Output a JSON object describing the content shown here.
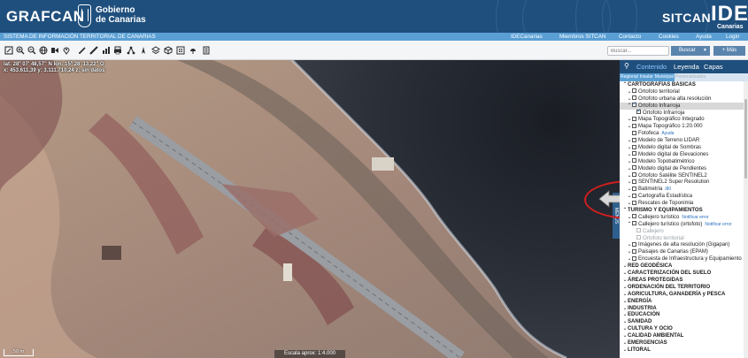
{
  "header": {
    "brand": "GRAFCAN",
    "gov_line1": "Gobierno",
    "gov_line2": "de Canarias",
    "sitcan": "SITCAN",
    "ide": "IDE",
    "ide_sub": "Canarias",
    "bg_color": "#1f4f7d"
  },
  "nav": {
    "title": "SISTEMA DE INFORMACIÓN TERRITORIAL DE CANARIAS",
    "links": [
      "IDECanarias",
      "Miembros SITCAN",
      "Contacto",
      "Cookies",
      "Ayuda",
      "Login"
    ],
    "bg_color": "#5a9fd4"
  },
  "toolbar": {
    "icons": [
      "measure-icon",
      "zoom-in-icon",
      "zoom-out-icon",
      "globe-icon",
      "share-icon",
      "location-icon",
      "draw-icon",
      "ruler-icon",
      "chart-icon",
      "print-icon",
      "network-icon",
      "compass-icon",
      "layers-icon",
      "cube-icon",
      "building-icon",
      "weather-icon",
      "document-icon"
    ],
    "search_placeholder": "Buscar...",
    "search_button": "Buscar",
    "more_button": "+ Más"
  },
  "map": {
    "coord_line1": "lat: 28º 07' 48,57\" N  lon: 15º 28' 13,22\" O",
    "coord_line2": "x: 453.611,39  y: 3.111.710,24  z: sin datos",
    "scale_bar": "50 m",
    "scale_text": "Escala aprox: 1:4.000",
    "side_tab": "MENÚS"
  },
  "panel": {
    "search_icon": "search-icon",
    "tabs": [
      "Contenido",
      "Leyenda",
      "Capas"
    ],
    "active_tab": "Contenido",
    "subtabs": [
      "Regional",
      "Insular",
      "Municipal",
      "Personalizados"
    ],
    "tree": [
      {
        "chev": "^",
        "cb": "none",
        "label": "CARTOGRAFÍAS BÁSICAS",
        "indent": 0,
        "cat": true
      },
      {
        "chev": "v",
        "cb": "off",
        "label": "Ortofoto territorial",
        "indent": 1
      },
      {
        "chev": "v",
        "cb": "off",
        "label": "Ortofoto urbana alta resolución",
        "indent": 1
      },
      {
        "chev": "^",
        "cb": "on",
        "label": "Ortofoto Infrarroja",
        "indent": 1,
        "selected": true
      },
      {
        "chev": "",
        "cb": "on",
        "label": "Ortofoto Infrarroja",
        "indent": 2
      },
      {
        "chev": "v",
        "cb": "off",
        "label": "Mapa Topográfico Integrado",
        "indent": 1
      },
      {
        "chev": "v",
        "cb": "off",
        "label": "Mapa Topográfico 1:20.000",
        "indent": 1
      },
      {
        "chev": "",
        "cb": "off",
        "label": "Fotofeca",
        "indent": 1,
        "note": "Ayuda"
      },
      {
        "chev": "v",
        "cb": "off",
        "label": "Modelo de Terreno LIDAR",
        "indent": 1
      },
      {
        "chev": "v",
        "cb": "off",
        "label": "Modelo digital de Sombras",
        "indent": 1
      },
      {
        "chev": "v",
        "cb": "off",
        "label": "Modelo digital de Elevaciones",
        "indent": 1
      },
      {
        "chev": "v",
        "cb": "off",
        "label": "Modelo Topobatimétrico",
        "indent": 1
      },
      {
        "chev": "v",
        "cb": "off",
        "label": "Modelo digital de Pendientes",
        "indent": 1
      },
      {
        "chev": "v",
        "cb": "off",
        "label": "Ortofoto Satélite SENTINEL2",
        "indent": 1
      },
      {
        "chev": "v",
        "cb": "off",
        "label": "SENTINEL2 Super Resolution",
        "indent": 1
      },
      {
        "chev": "v",
        "cb": "off",
        "label": "Batimetría",
        "indent": 1,
        "note": "i80"
      },
      {
        "chev": "v",
        "cb": "off",
        "label": "Cartografía Estadística",
        "indent": 1
      },
      {
        "chev": "v",
        "cb": "off",
        "label": "Rescates de Toponimia",
        "indent": 1
      },
      {
        "chev": "^",
        "cb": "none",
        "label": "TURISMO Y EQUIPAMIENTOS",
        "indent": 0,
        "cat": true
      },
      {
        "chev": "v",
        "cb": "off",
        "label": "Callejero turístico",
        "indent": 1,
        "note": "Notificar error"
      },
      {
        "chev": "^",
        "cb": "off",
        "label": "Callejero turístico (ortofoto)",
        "indent": 1,
        "note": "Notificar error"
      },
      {
        "chev": "",
        "cb": "dis",
        "label": "Callejero",
        "indent": 2,
        "dim": true
      },
      {
        "chev": "",
        "cb": "dis",
        "label": "Ortofoto territorial",
        "indent": 2,
        "dim": true
      },
      {
        "chev": "v",
        "cb": "off",
        "label": "Imágenes de alta resolución (Gigapan)",
        "indent": 1
      },
      {
        "chev": "v",
        "cb": "off",
        "label": "Paisajes de Canarias (EPAM)",
        "indent": 1
      },
      {
        "chev": "v",
        "cb": "off",
        "label": "Encuesta de Infraestructura y Equipamiento",
        "indent": 1
      },
      {
        "chev": "v",
        "cb": "none",
        "label": "RED GEODÉSICA",
        "indent": 0,
        "cat": true
      },
      {
        "chev": "v",
        "cb": "none",
        "label": "CARACTERIZACIÓN DEL SUELO",
        "indent": 0,
        "cat": true
      },
      {
        "chev": "v",
        "cb": "none",
        "label": "ÁREAS PROTEGIDAS",
        "indent": 0,
        "cat": true
      },
      {
        "chev": "v",
        "cb": "none",
        "label": "ORDENACIÓN DEL TERRITORIO",
        "indent": 0,
        "cat": true
      },
      {
        "chev": "v",
        "cb": "none",
        "label": "AGRICULTURA, GANADERÍA y PESCA",
        "indent": 0,
        "cat": true
      },
      {
        "chev": "v",
        "cb": "none",
        "label": "ENERGÍA",
        "indent": 0,
        "cat": true
      },
      {
        "chev": "v",
        "cb": "none",
        "label": "INDUSTRIA",
        "indent": 0,
        "cat": true
      },
      {
        "chev": "v",
        "cb": "none",
        "label": "EDUCACIÓN",
        "indent": 0,
        "cat": true
      },
      {
        "chev": "v",
        "cb": "none",
        "label": "SANIDAD",
        "indent": 0,
        "cat": true
      },
      {
        "chev": "v",
        "cb": "none",
        "label": "CULTURA Y OCIO",
        "indent": 0,
        "cat": true
      },
      {
        "chev": "v",
        "cb": "none",
        "label": "CALIDAD AMBIENTAL",
        "indent": 0,
        "cat": true
      },
      {
        "chev": "v",
        "cb": "none",
        "label": "EMERGENCIAS",
        "indent": 0,
        "cat": true
      },
      {
        "chev": "v",
        "cb": "none",
        "label": "LITORAL",
        "indent": 0,
        "cat": true
      }
    ]
  }
}
